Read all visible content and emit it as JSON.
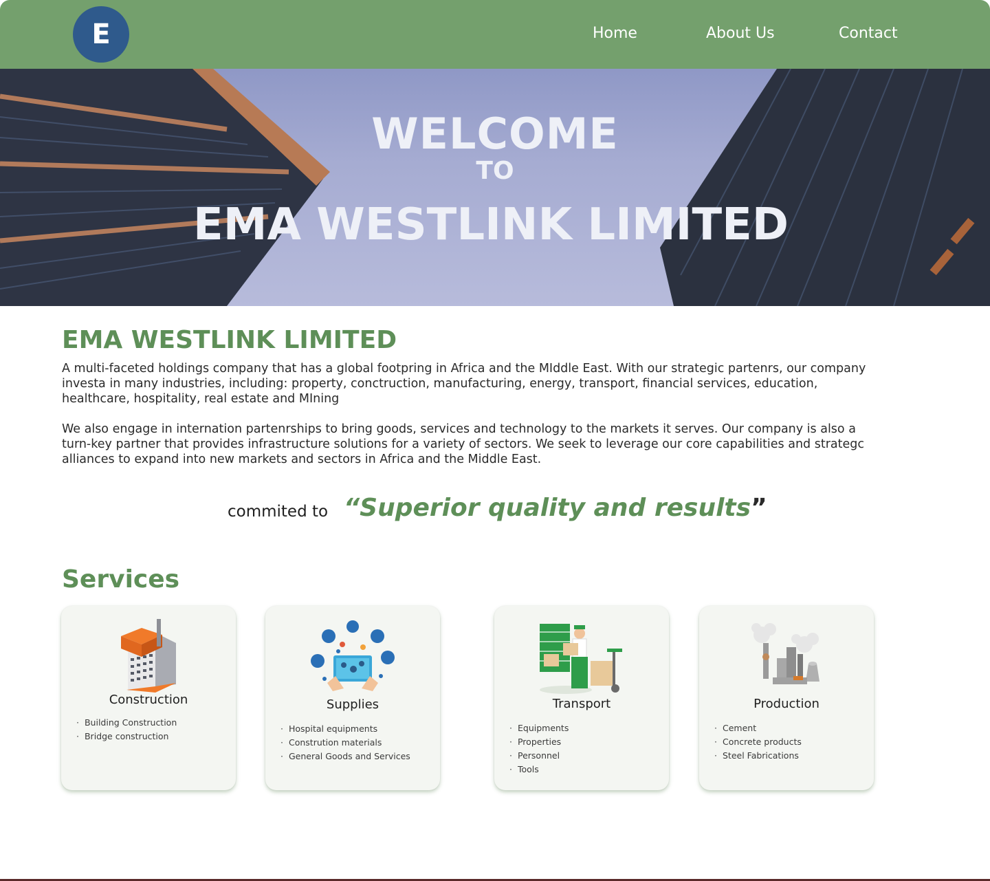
{
  "header": {
    "logo_letter": "E",
    "nav": [
      {
        "label": "Home"
      },
      {
        "label": "About Us"
      },
      {
        "label": "Contact"
      }
    ]
  },
  "hero": {
    "line1": "WELCOME",
    "line2": "TO",
    "line3": "EMA WESTLINK LIMITED"
  },
  "about": {
    "title": "EMA WESTLINK LIMITED",
    "paragraph1": "A multi-faceted holdings company that has a global footpring in Africa and the MIddle East. With our strategic partenrs, our company investa in many industries, including: property, conctruction, manufacturing, energy, transport, financial services, education, healthcare, hospitality, real estate and MIning",
    "paragraph2": "We also engage in internation partenrships to bring goods, services and technology to the markets it serves. Our company is also a turn-key partner that provides infrastructure solutions for a variety of sectors. We seek to leverage our core capabilities and strategc alliances to expand into new markets and sectors in Africa and the Middle East."
  },
  "tagline": {
    "lead": "commited to",
    "quote": "“Superior quality and results",
    "close": "”"
  },
  "services": {
    "title": "Services",
    "cards": [
      {
        "title": "Construction",
        "icon": "building-icon",
        "items": [
          "Building Construction",
          "Bridge construction"
        ]
      },
      {
        "title": "Supplies",
        "icon": "supplies-icon",
        "items": [
          "Hospital equipments",
          "Constrution materials",
          "General Goods and Services"
        ]
      },
      {
        "title": "Transport",
        "icon": "delivery-worker-icon",
        "items": [
          "Equipments",
          "Properties",
          "Personnel",
          "Tools"
        ]
      },
      {
        "title": "Production",
        "icon": "factory-icon",
        "items": [
          "Cement",
          "Concrete products",
          "Steel Fabrications"
        ]
      }
    ]
  },
  "colors": {
    "header_bg": "#74a06d",
    "accent_green": "#5e8f58",
    "logo_blue": "#2f5a8c"
  }
}
